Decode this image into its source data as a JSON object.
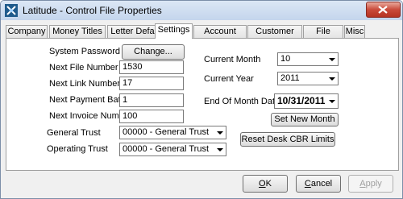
{
  "window": {
    "title": "Latitude - Control File Properties"
  },
  "tabs": [
    {
      "label": "Company"
    },
    {
      "label": "Money Titles"
    },
    {
      "label": "Letter Defaults"
    },
    {
      "label": "Settings"
    },
    {
      "label": "Account Titles"
    },
    {
      "label": "Customer Titles"
    },
    {
      "label": "File Paths"
    },
    {
      "label": "Misc"
    }
  ],
  "active_tab": "Settings",
  "settings": {
    "system_password_label": "System Password",
    "change_button": "Change...",
    "next_file_number_label": "Next File Number",
    "next_file_number": "1530",
    "next_link_number_label": "Next Link Number",
    "next_link_number": "17",
    "next_payment_batch_label": "Next Payment Batch",
    "next_payment_batch": "1",
    "next_invoice_number_label": "Next Invoice Number",
    "next_invoice_number": "100",
    "general_trust_label": "General Trust",
    "general_trust": "00000 - General Trust",
    "operating_trust_label": "Operating Trust",
    "operating_trust": "00000 - General Trust",
    "current_month_label": "Current Month",
    "current_month": "10",
    "current_year_label": "Current Year",
    "current_year": "2011",
    "end_of_month_date_label": "End Of Month Date",
    "end_of_month_date": "10/31/2011",
    "set_new_month_button": "Set New Month",
    "reset_desk_button": "Reset Desk CBR Limits"
  },
  "footer": {
    "ok_mnemonic": "O",
    "ok_rest": "K",
    "cancel_mnemonic": "C",
    "cancel_rest": "ancel",
    "apply_mnemonic": "A",
    "apply_rest": "pply"
  },
  "colors": {
    "close_button": "#c94a3a",
    "titlebar": "#c4d5ec"
  }
}
